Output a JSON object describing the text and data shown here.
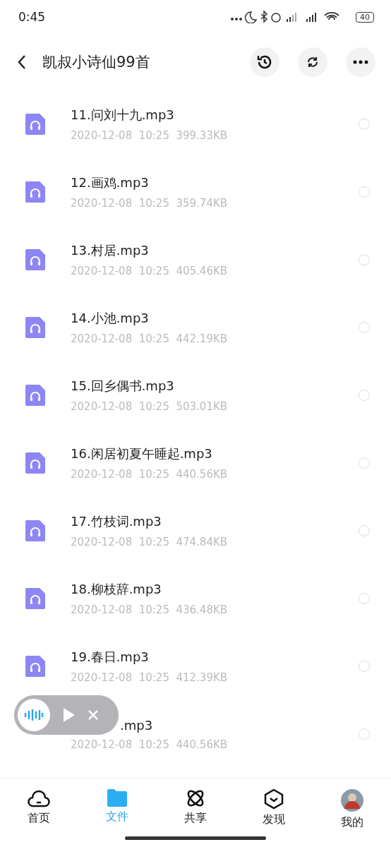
{
  "status_bar": {
    "time": "0:45",
    "battery": "40"
  },
  "header": {
    "title": "凯叔小诗仙99首"
  },
  "files": [
    {
      "name": "11.问刘十九.mp3",
      "date": "2020-12-08",
      "time": "10:25",
      "size": "399.33KB",
      "selected": false,
      "covered": false
    },
    {
      "name": "12.画鸡.mp3",
      "date": "2020-12-08",
      "time": "10:25",
      "size": "359.74KB",
      "selected": false,
      "covered": false
    },
    {
      "name": "13.村居.mp3",
      "date": "2020-12-08",
      "time": "10:25",
      "size": "405.46KB",
      "selected": false,
      "covered": false
    },
    {
      "name": "14.小池.mp3",
      "date": "2020-12-08",
      "time": "10:25",
      "size": "442.19KB",
      "selected": false,
      "covered": false
    },
    {
      "name": "15.回乡偶书.mp3",
      "date": "2020-12-08",
      "time": "10:25",
      "size": "503.01KB",
      "selected": false,
      "covered": false
    },
    {
      "name": "16.闲居初夏午睡起.mp3",
      "date": "2020-12-08",
      "time": "10:25",
      "size": "440.56KB",
      "selected": false,
      "covered": false
    },
    {
      "name": "17.竹枝词.mp3",
      "date": "2020-12-08",
      "time": "10:25",
      "size": "474.84KB",
      "selected": false,
      "covered": false
    },
    {
      "name": "18.柳枝辞.mp3",
      "date": "2020-12-08",
      "time": "10:25",
      "size": "436.48KB",
      "selected": false,
      "covered": false
    },
    {
      "name": "19.春日.mp3",
      "date": "2020-12-08",
      "time": "10:25",
      "size": "412.39KB",
      "selected": false,
      "covered": false
    },
    {
      "name": ".mp3",
      "date": "2020-12-08",
      "time": "10:25",
      "size": "440.56KB",
      "selected": false,
      "covered": true
    }
  ],
  "tabs": [
    {
      "label": "首页",
      "kind": "home",
      "selected": false
    },
    {
      "label": "文件",
      "kind": "files",
      "selected": true
    },
    {
      "label": "共享",
      "kind": "share",
      "selected": false
    },
    {
      "label": "发现",
      "kind": "discover",
      "selected": false
    },
    {
      "label": "我的",
      "kind": "me",
      "selected": false
    }
  ]
}
